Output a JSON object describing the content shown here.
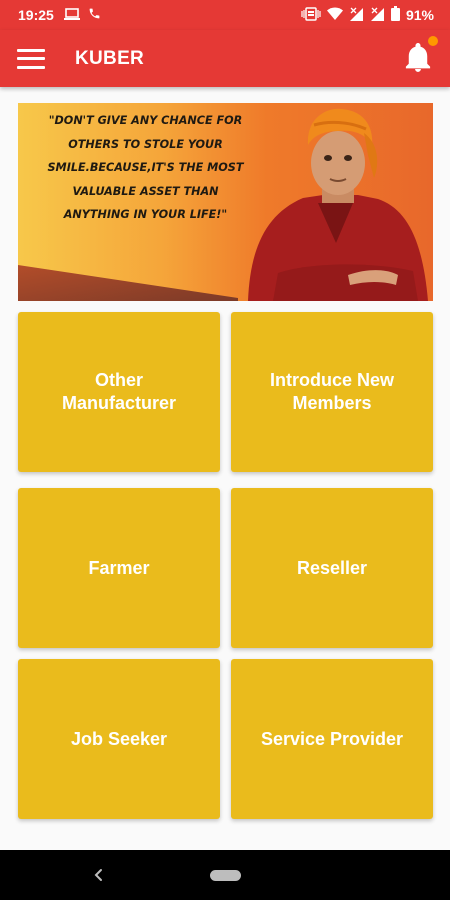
{
  "status_bar": {
    "time": "19:25",
    "battery": "91%",
    "left_icons": [
      "laptop-icon",
      "phone-icon"
    ],
    "right_icons": [
      "vibrate-icon",
      "wifi-icon",
      "signal-icon",
      "signal-icon",
      "battery-icon"
    ]
  },
  "app_bar": {
    "title": "KUBER",
    "color": "#e53935",
    "notification_dot_color": "#ff9800"
  },
  "banner": {
    "quote": "\"DON'T GIVE ANY CHANCE FOR OTHERS TO STOLE YOUR SMILE.BECAUSE,IT'S THE MOST VALUABLE ASSET THAN ANYTHING IN YOUR LIFE!\""
  },
  "tiles": [
    {
      "label": "Other Manufacturer"
    },
    {
      "label": "Introduce New Members"
    },
    {
      "label": "Farmer"
    },
    {
      "label": "Reseller"
    },
    {
      "label": "Job Seeker"
    },
    {
      "label": "Service Provider"
    }
  ],
  "tile_color": "#eabb1c",
  "nav_bar": {
    "icons": [
      "back-icon",
      "home-pill-icon"
    ]
  }
}
